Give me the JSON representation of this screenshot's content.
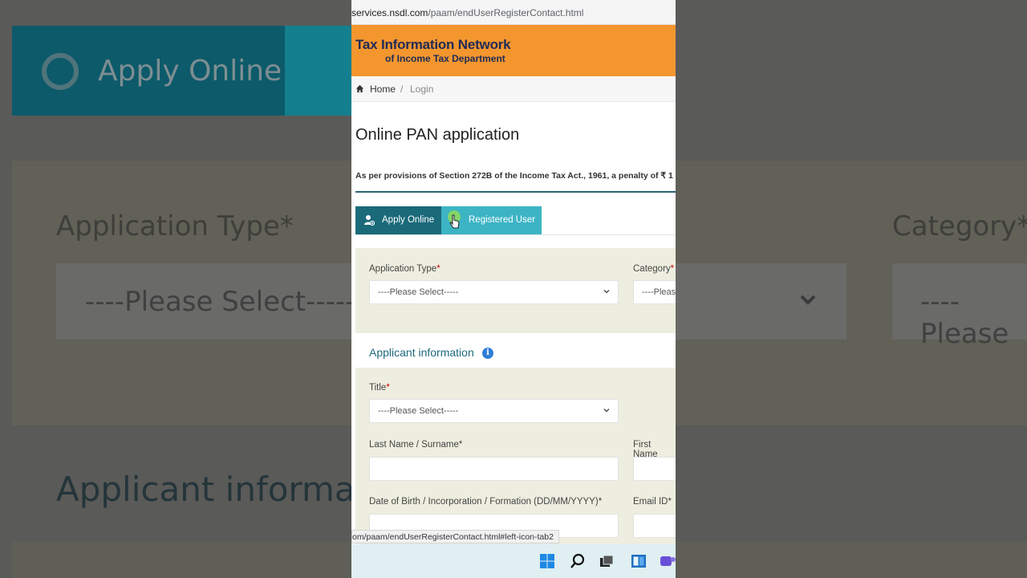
{
  "browser": {
    "url_host": "services.nsdl.com",
    "url_path": "/paam/endUserRegisterContact.html"
  },
  "header": {
    "title": "Tax Information Network",
    "subtitle": "of Income Tax Department"
  },
  "breadcrumb": {
    "home": "Home",
    "separator": "/",
    "current": "Login"
  },
  "page": {
    "title": "Online PAN application",
    "notice": "As per provisions of Section 272B of the Income Tax Act., 1961, a penalty of ₹ 1"
  },
  "tabs": {
    "apply": "Apply Online",
    "registered": "Registered User"
  },
  "form": {
    "application_type_label": "Application Type",
    "category_label": "Category",
    "required_mark": "*",
    "please_select": "----Please Select-----",
    "category_placeholder": "----Please",
    "applicant_info": "Applicant information",
    "info_icon_glyph": "i",
    "title_label": "Title",
    "last_name_label": "Last Name / Surname",
    "first_name_label": "First Name",
    "dob_label": "Date of Birth / Incorporation / Formation (DD/MM/YYYY)",
    "email_label": "Email ID"
  },
  "status_link": "om/paam/endUserRegisterContact.html#left-icon-tab2",
  "background": {
    "apply": "Apply Online",
    "application_type": "Application Type*",
    "category": "Category*",
    "please_select": "----Please Select-----",
    "please_partial": "----Please",
    "applicant": "Applicant informat"
  },
  "colors": {
    "header_orange": "#f3962e",
    "tab_dark": "#1a6a7a",
    "tab_light": "#3cb4c4",
    "panel_bg": "#eeeee0",
    "section_heading": "#1f6a7d"
  },
  "icons": {
    "home": "home-icon",
    "user_add": "user-add-icon",
    "chevron": "chevron-down-icon",
    "info": "info-icon",
    "windows": "windows-start-icon",
    "search": "search-icon",
    "task_view": "task-view-icon",
    "widgets": "widgets-icon",
    "chat": "chat-icon"
  }
}
